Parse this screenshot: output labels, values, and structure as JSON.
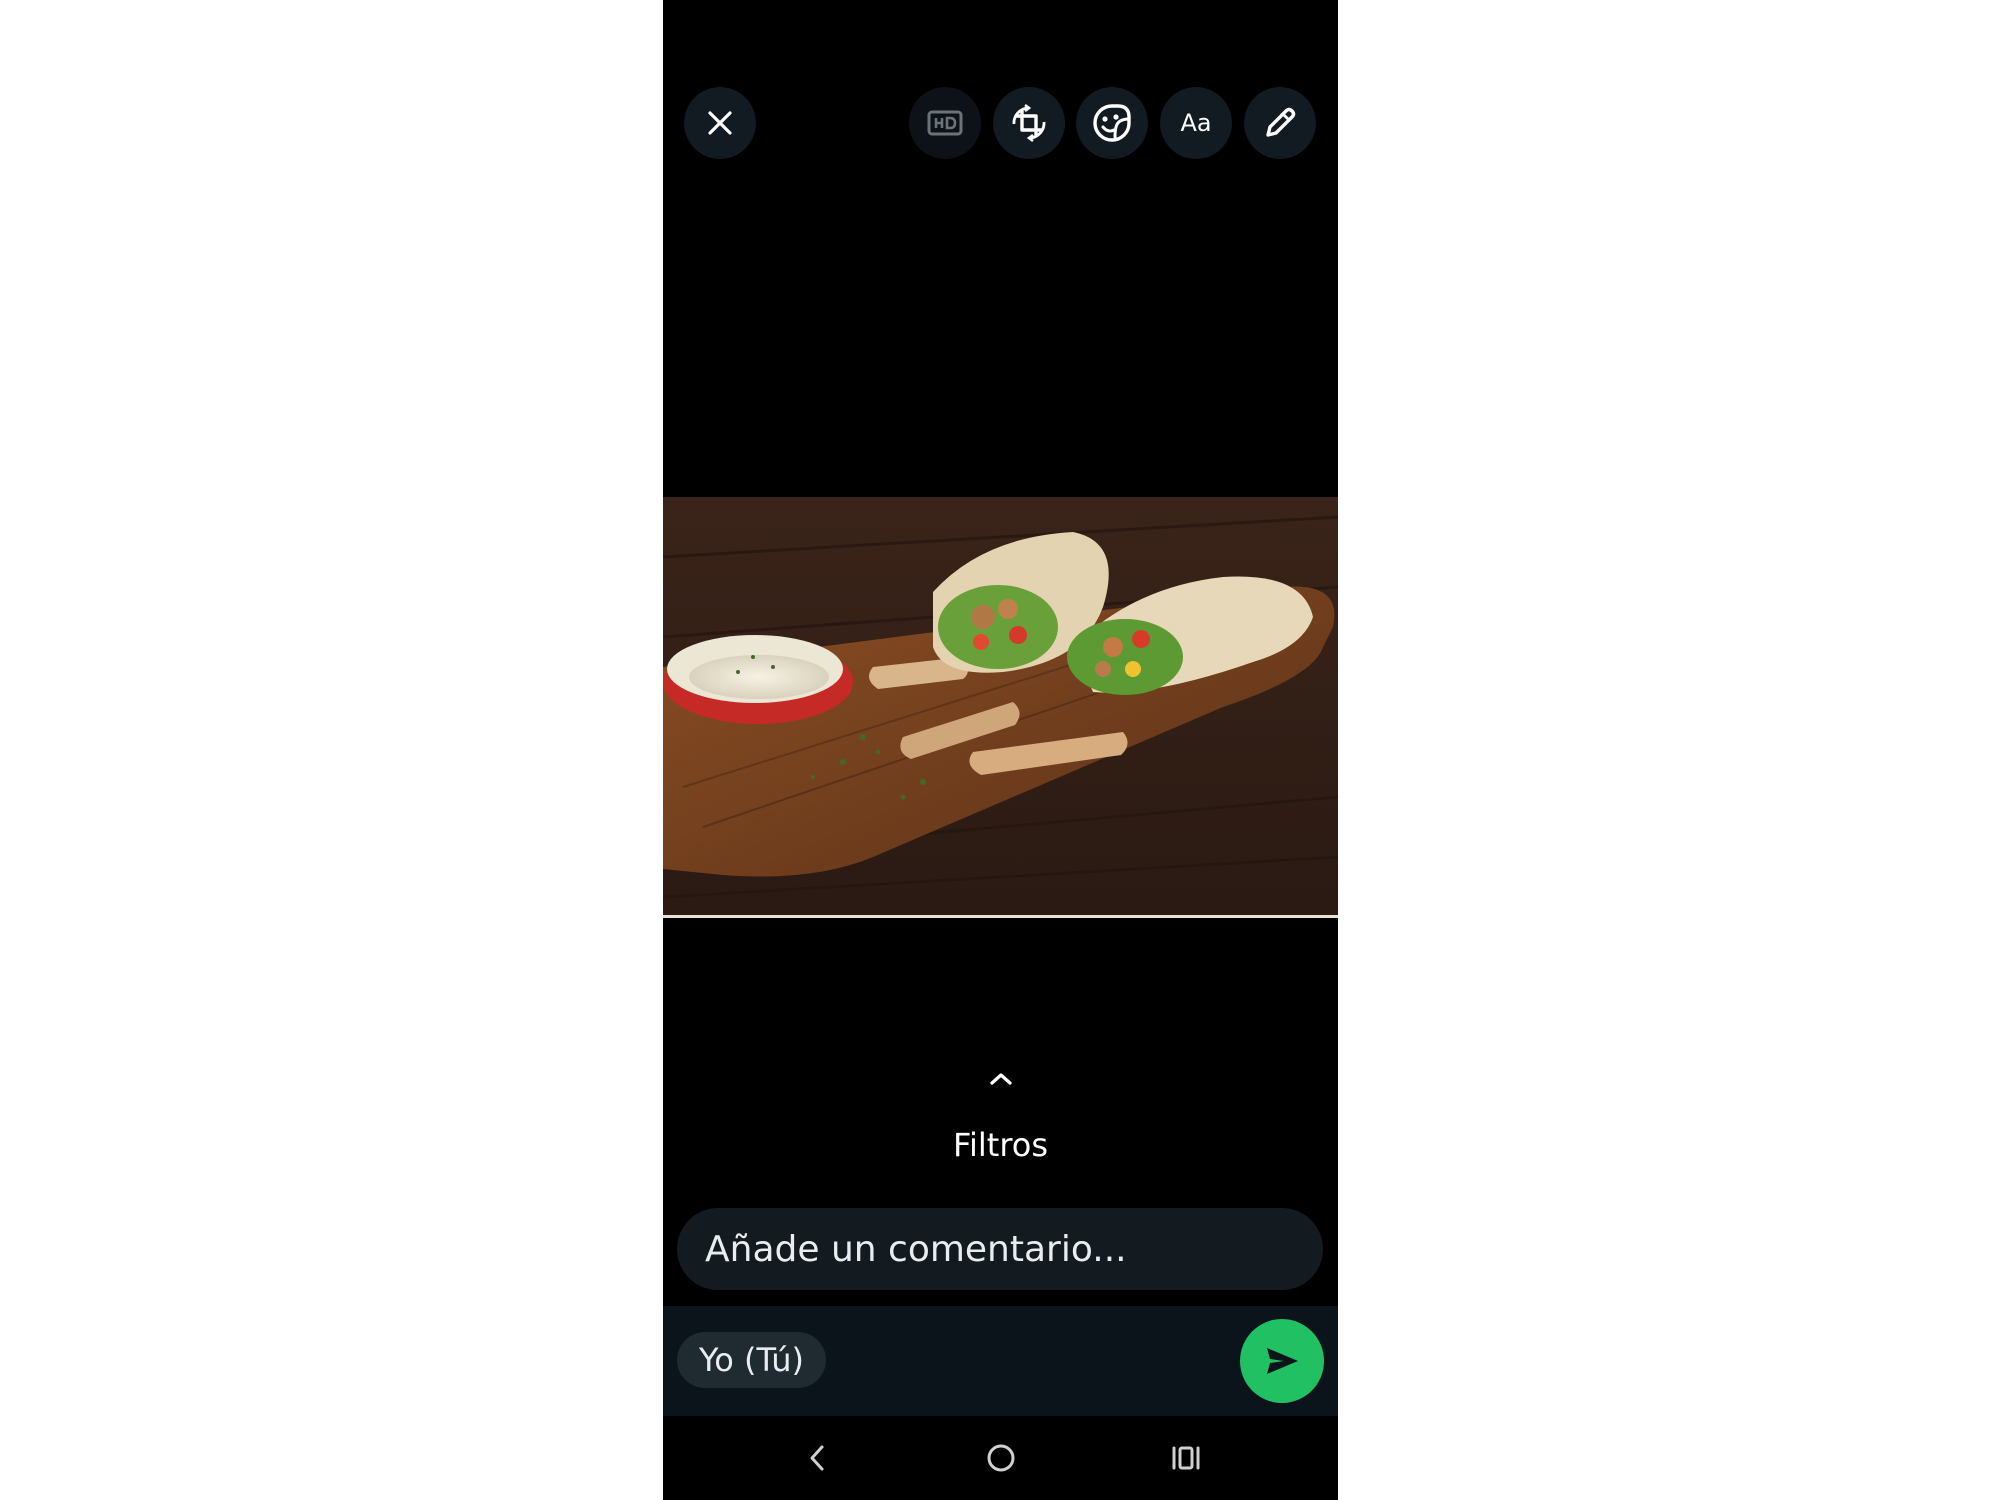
{
  "toolbar": {
    "close_icon": "close-icon",
    "hd_icon": "hd-icon",
    "crop_rotate_icon": "crop-rotate-icon",
    "sticker_icon": "sticker-icon",
    "text_label": "Aa",
    "draw_icon": "pencil-icon"
  },
  "image": {
    "subject": "food-photo"
  },
  "filters": {
    "chevron_icon": "chevron-up-icon",
    "label": "Filtros"
  },
  "comment": {
    "placeholder": "Añade un comentario..."
  },
  "recipient": {
    "label": "Yo (Tú)"
  },
  "send": {
    "icon": "send-icon",
    "color": "#21c063"
  },
  "navigation": {
    "back_icon": "back-icon",
    "home_icon": "home-icon",
    "recents_icon": "recents-icon"
  }
}
